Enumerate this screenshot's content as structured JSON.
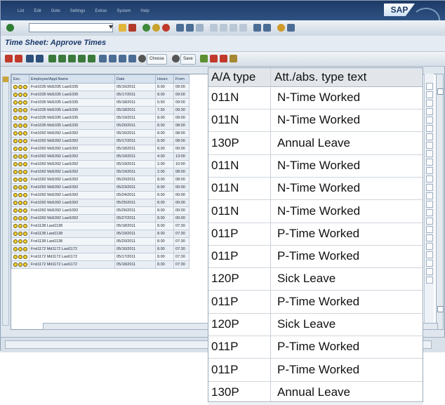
{
  "app": {
    "menu": [
      "List",
      "Edit",
      "Goto",
      "Settings",
      "Extras",
      "System",
      "Help"
    ],
    "logo": "SAP"
  },
  "titlearea": {
    "title": "Time Sheet: Approve Times"
  },
  "apptoolbar": {
    "choose_label": "Choose",
    "save_label": "Save"
  },
  "table": {
    "headers": [
      "Exc.",
      "Employee/Appl.Name",
      "Date",
      "Hours",
      "From"
    ],
    "rows": [
      [
        "Frst1035 Md1035 Last1035",
        "05/16/2011",
        "8.00",
        "09:00"
      ],
      [
        "Frst1035 Md1035 Last1035",
        "05/17/2011",
        "8.00",
        "09:00"
      ],
      [
        "Frst1035 Md1035 Last1035",
        "05/18/2011",
        "0.50",
        "09:00"
      ],
      [
        "Frst1035 Md1035 Last1035",
        "05/18/2011",
        "7.50",
        "09:30"
      ],
      [
        "Frst1035 Md1035 Last1035",
        "05/19/2011",
        "8.00",
        "09:00"
      ],
      [
        "Frst1035 Md1035 Last1035",
        "05/20/2011",
        "8.00",
        "08:00"
      ],
      [
        "Frst1092 Md1092 Last1092",
        "05/16/2011",
        "8.00",
        "08:00"
      ],
      [
        "Frst1092 Md1092 Last1092",
        "05/17/2011",
        "8.00",
        "08:00"
      ],
      [
        "Frst1092 Md1092 Last1092",
        "05/18/2011",
        "8.00",
        "00:00"
      ],
      [
        "Frst1092 Md1092 Last1092",
        "05/19/2011",
        "4.00",
        "13:00"
      ],
      [
        "Frst1092 Md1092 Last1092",
        "05/19/2011",
        "2.00",
        "10:00"
      ],
      [
        "Frst1092 Md1092 Last1092",
        "05/19/2011",
        "2.00",
        "08:00"
      ],
      [
        "Frst1092 Md1092 Last1092",
        "05/20/2011",
        "8.00",
        "08:00"
      ],
      [
        "Frst1092 Md1092 Last1092",
        "05/23/2011",
        "8.00",
        "00:00"
      ],
      [
        "Frst1092 Md1092 Last1092",
        "05/24/2011",
        "8.00",
        "00:00"
      ],
      [
        "Frst1092 Md1092 Last1092",
        "05/25/2011",
        "8.00",
        "00:00"
      ],
      [
        "Frst1092 Md1092 Last1092",
        "05/26/2011",
        "8.00",
        "00:00"
      ],
      [
        "Frst1092 Md1092 Last1092",
        "05/27/2011",
        "8.00",
        "00:00"
      ],
      [
        "Frst1138 Last1138",
        "05/18/2011",
        "8.00",
        "07:30"
      ],
      [
        "Frst1138 Last1138",
        "05/19/2011",
        "8.00",
        "07:30"
      ],
      [
        "Frst1138 Last1138",
        "05/20/2011",
        "8.00",
        "07:30"
      ],
      [
        "Frst1172 Md1172 Last1172",
        "05/16/2011",
        "8.00",
        "07:30"
      ],
      [
        "Frst1172 Md1172 Last1172",
        "05/17/2011",
        "8.00",
        "07:30"
      ],
      [
        "Frst1172 Md1172 Last1172",
        "05/18/2011",
        "8.00",
        "07:30"
      ]
    ]
  },
  "zoom": {
    "headers": [
      "A/A type",
      "Att./abs. type text"
    ],
    "rows": [
      [
        "011N",
        "N-Time Worked"
      ],
      [
        "011N",
        "N-Time Worked"
      ],
      [
        "130P",
        "Annual Leave"
      ],
      [
        "011N",
        "N-Time Worked"
      ],
      [
        "011N",
        "N-Time Worked"
      ],
      [
        "011N",
        "N-Time Worked"
      ],
      [
        "011P",
        "P-Time Worked"
      ],
      [
        "011P",
        "P-Time Worked"
      ],
      [
        "120P",
        "Sick Leave"
      ],
      [
        "011P",
        "P-Time Worked"
      ],
      [
        "120P",
        "Sick Leave"
      ],
      [
        "011P",
        "P-Time Worked"
      ],
      [
        "011P",
        "P-Time Worked"
      ],
      [
        "130P",
        "Annual Leave"
      ]
    ]
  },
  "colors": {
    "title": "#1b3a6b",
    "titlebar": "#1d3a66",
    "exception": "#f4cf2c"
  }
}
